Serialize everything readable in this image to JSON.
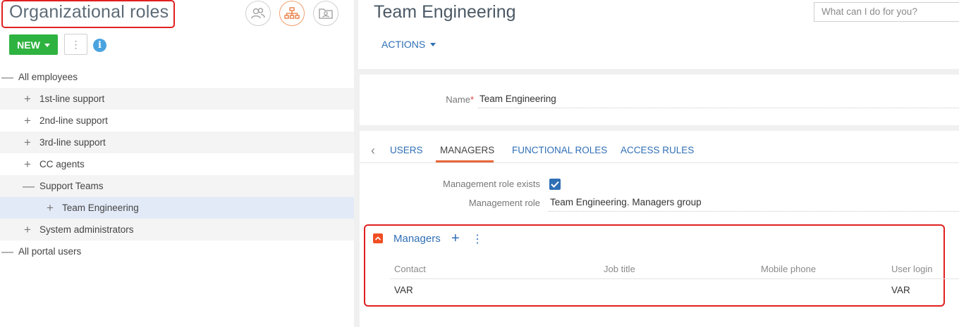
{
  "left": {
    "title": "Organizational roles",
    "new_label": "NEW",
    "dots_label": "⋮",
    "info_label": "i",
    "view_buttons": [
      "users-view-icon",
      "org-chart-icon",
      "role-folder-icon"
    ],
    "tree": [
      {
        "toggle": "—",
        "label": "All employees"
      },
      {
        "toggle": "+",
        "label": "1st-line support"
      },
      {
        "toggle": "+",
        "label": "2nd-line support"
      },
      {
        "toggle": "+",
        "label": "3rd-line support"
      },
      {
        "toggle": "+",
        "label": "CC agents"
      },
      {
        "toggle": "—",
        "label": "Support Teams"
      },
      {
        "toggle": "+",
        "label": "Team Engineering"
      },
      {
        "toggle": "+",
        "label": "System administrators"
      },
      {
        "toggle": "—",
        "label": "All portal users"
      }
    ]
  },
  "header": {
    "record_title": "Team Engineering",
    "search_placeholder": "What can I do for you?",
    "actions_label": "ACTIONS"
  },
  "form": {
    "name_label": "Name",
    "name_required": "*",
    "name_value": "Team Engineering"
  },
  "tabs": {
    "back_icon": "‹",
    "items": [
      "USERS",
      "MANAGERS",
      "FUNCTIONAL ROLES",
      "ACCESS RULES"
    ],
    "active": "MANAGERS"
  },
  "managers_tab": {
    "role_exists_label": "Management role exists",
    "role_exists_checked": true,
    "role_label": "Management role",
    "role_value": "Team Engineering. Managers group"
  },
  "managers_detail": {
    "title": "Managers",
    "add_label": "+",
    "menu_label": "⋮",
    "columns": [
      "Contact",
      "Job title",
      "Mobile phone",
      "User login"
    ],
    "rows": [
      {
        "contact": "VAR",
        "job_title": "",
        "mobile_phone": "",
        "user_login": "VAR"
      }
    ]
  },
  "colors": {
    "accent_orange": "#f04e23",
    "link_blue": "#2f6fb5",
    "new_green": "#2fb340",
    "highlight_red": "#e02020"
  }
}
